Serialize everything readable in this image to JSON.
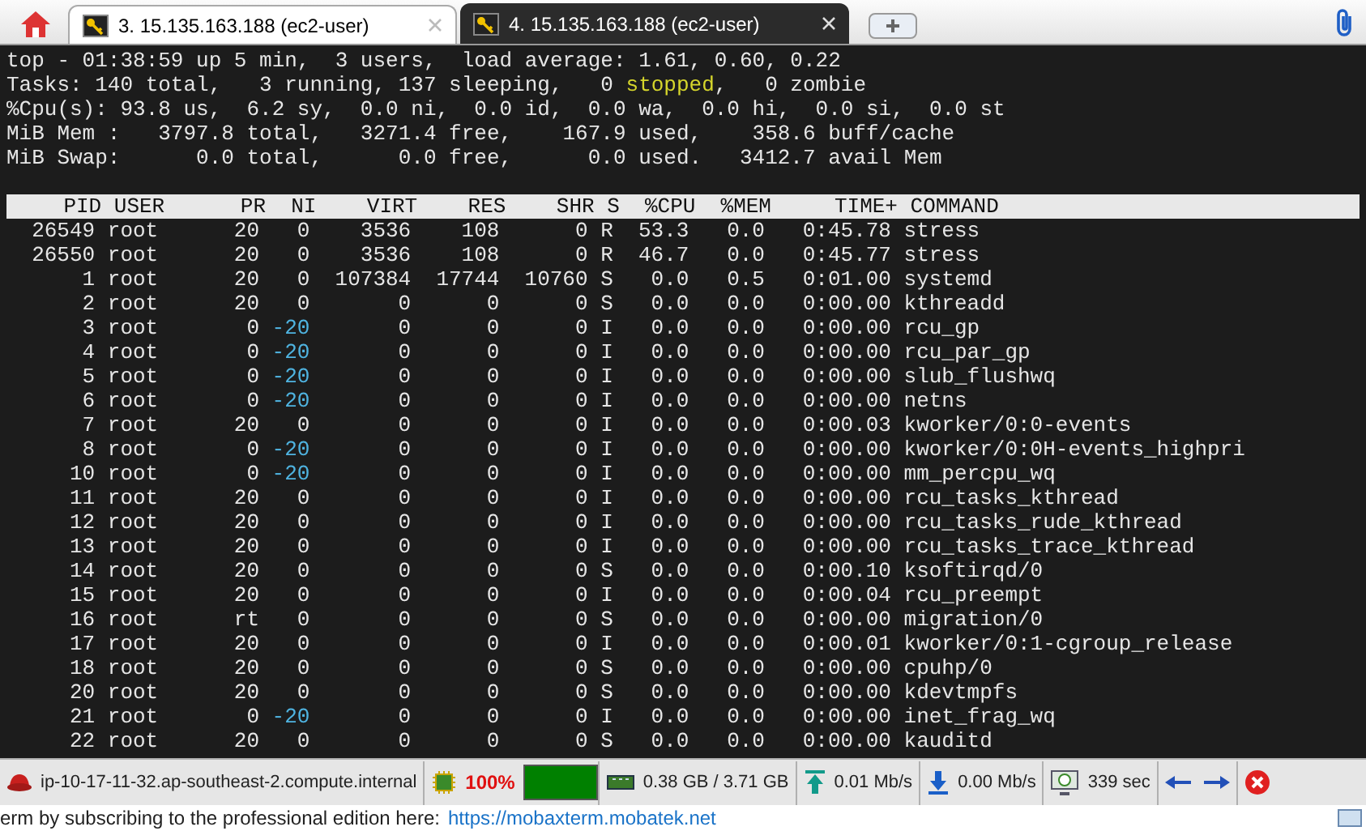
{
  "tabs": [
    {
      "label": "3. 15.135.163.188 (ec2-user)",
      "selected": false
    },
    {
      "label": "4. 15.135.163.188 (ec2-user)",
      "selected": true
    }
  ],
  "terminal": {
    "summary_lines": [
      [
        {
          "text": "top - 01:38:59 up 5 min,  3 users,  load average: 1.61, 0.60, 0.22",
          "highlighted": false
        }
      ],
      [
        {
          "text": "Tasks: 140 total,   3 running, 137 sleeping,   0 ",
          "highlighted": false
        },
        {
          "text": "stopped",
          "highlighted": true
        },
        {
          "text": ",   0 zombie",
          "highlighted": false
        }
      ],
      [
        {
          "text": "%Cpu(s): 93.8 us,  6.2 sy,  0.0 ni,  0.0 id,  0.0 wa,  0.0 hi,  0.0 si,  0.0 st",
          "highlighted": false
        }
      ],
      [
        {
          "text": "MiB Mem :   3797.8 total,   3271.4 free,    167.9 used,    358.6 buff/cache",
          "highlighted": false
        }
      ],
      [
        {
          "text": "MiB Swap:      0.0 total,      0.0 free,      0.0 used.   3412.7 avail Mem",
          "highlighted": false
        }
      ]
    ],
    "columns": [
      "PID",
      "USER",
      "PR",
      "NI",
      "VIRT",
      "RES",
      "SHR",
      "S",
      "%CPU",
      "%MEM",
      "TIME+",
      "COMMAND"
    ],
    "rows": [
      {
        "cells": [
          "26549",
          "root",
          "20",
          "0",
          "3536",
          "108",
          "0",
          "R",
          "53.3",
          "0.0",
          "0:45.78",
          "stress"
        ],
        "ni_highlighted": false
      },
      {
        "cells": [
          "26550",
          "root",
          "20",
          "0",
          "3536",
          "108",
          "0",
          "R",
          "46.7",
          "0.0",
          "0:45.77",
          "stress"
        ],
        "ni_highlighted": false
      },
      {
        "cells": [
          "1",
          "root",
          "20",
          "0",
          "107384",
          "17744",
          "10760",
          "S",
          "0.0",
          "0.5",
          "0:01.00",
          "systemd"
        ],
        "ni_highlighted": false
      },
      {
        "cells": [
          "2",
          "root",
          "20",
          "0",
          "0",
          "0",
          "0",
          "S",
          "0.0",
          "0.0",
          "0:00.00",
          "kthreadd"
        ],
        "ni_highlighted": false
      },
      {
        "cells": [
          "3",
          "root",
          "0",
          "-20",
          "0",
          "0",
          "0",
          "I",
          "0.0",
          "0.0",
          "0:00.00",
          "rcu_gp"
        ],
        "ni_highlighted": true
      },
      {
        "cells": [
          "4",
          "root",
          "0",
          "-20",
          "0",
          "0",
          "0",
          "I",
          "0.0",
          "0.0",
          "0:00.00",
          "rcu_par_gp"
        ],
        "ni_highlighted": true
      },
      {
        "cells": [
          "5",
          "root",
          "0",
          "-20",
          "0",
          "0",
          "0",
          "I",
          "0.0",
          "0.0",
          "0:00.00",
          "slub_flushwq"
        ],
        "ni_highlighted": true
      },
      {
        "cells": [
          "6",
          "root",
          "0",
          "-20",
          "0",
          "0",
          "0",
          "I",
          "0.0",
          "0.0",
          "0:00.00",
          "netns"
        ],
        "ni_highlighted": true
      },
      {
        "cells": [
          "7",
          "root",
          "20",
          "0",
          "0",
          "0",
          "0",
          "I",
          "0.0",
          "0.0",
          "0:00.03",
          "kworker/0:0-events"
        ],
        "ni_highlighted": false
      },
      {
        "cells": [
          "8",
          "root",
          "0",
          "-20",
          "0",
          "0",
          "0",
          "I",
          "0.0",
          "0.0",
          "0:00.00",
          "kworker/0:0H-events_highpri"
        ],
        "ni_highlighted": true
      },
      {
        "cells": [
          "10",
          "root",
          "0",
          "-20",
          "0",
          "0",
          "0",
          "I",
          "0.0",
          "0.0",
          "0:00.00",
          "mm_percpu_wq"
        ],
        "ni_highlighted": true
      },
      {
        "cells": [
          "11",
          "root",
          "20",
          "0",
          "0",
          "0",
          "0",
          "I",
          "0.0",
          "0.0",
          "0:00.00",
          "rcu_tasks_kthread"
        ],
        "ni_highlighted": false
      },
      {
        "cells": [
          "12",
          "root",
          "20",
          "0",
          "0",
          "0",
          "0",
          "I",
          "0.0",
          "0.0",
          "0:00.00",
          "rcu_tasks_rude_kthread"
        ],
        "ni_highlighted": false
      },
      {
        "cells": [
          "13",
          "root",
          "20",
          "0",
          "0",
          "0",
          "0",
          "I",
          "0.0",
          "0.0",
          "0:00.00",
          "rcu_tasks_trace_kthread"
        ],
        "ni_highlighted": false
      },
      {
        "cells": [
          "14",
          "root",
          "20",
          "0",
          "0",
          "0",
          "0",
          "S",
          "0.0",
          "0.0",
          "0:00.10",
          "ksoftirqd/0"
        ],
        "ni_highlighted": false
      },
      {
        "cells": [
          "15",
          "root",
          "20",
          "0",
          "0",
          "0",
          "0",
          "I",
          "0.0",
          "0.0",
          "0:00.04",
          "rcu_preempt"
        ],
        "ni_highlighted": false
      },
      {
        "cells": [
          "16",
          "root",
          "rt",
          "0",
          "0",
          "0",
          "0",
          "S",
          "0.0",
          "0.0",
          "0:00.00",
          "migration/0"
        ],
        "ni_highlighted": false
      },
      {
        "cells": [
          "17",
          "root",
          "20",
          "0",
          "0",
          "0",
          "0",
          "I",
          "0.0",
          "0.0",
          "0:00.01",
          "kworker/0:1-cgroup_release"
        ],
        "ni_highlighted": false
      },
      {
        "cells": [
          "18",
          "root",
          "20",
          "0",
          "0",
          "0",
          "0",
          "S",
          "0.0",
          "0.0",
          "0:00.00",
          "cpuhp/0"
        ],
        "ni_highlighted": false
      },
      {
        "cells": [
          "20",
          "root",
          "20",
          "0",
          "0",
          "0",
          "0",
          "S",
          "0.0",
          "0.0",
          "0:00.00",
          "kdevtmpfs"
        ],
        "ni_highlighted": false
      },
      {
        "cells": [
          "21",
          "root",
          "0",
          "-20",
          "0",
          "0",
          "0",
          "I",
          "0.0",
          "0.0",
          "0:00.00",
          "inet_frag_wq"
        ],
        "ni_highlighted": true
      },
      {
        "cells": [
          "22",
          "root",
          "20",
          "0",
          "0",
          "0",
          "0",
          "S",
          "0.0",
          "0.0",
          "0:00.00",
          "kauditd"
        ],
        "ni_highlighted": false
      }
    ]
  },
  "status_bar": {
    "host": "ip-10-17-11-32.ap-southeast-2.compute.internal",
    "cpu": "100%",
    "memory": "0.38 GB / 3.71 GB",
    "upload": "0.01 Mb/s",
    "download": "0.00 Mb/s",
    "uptime": "339 sec"
  },
  "footer": {
    "text": "erm by subscribing to the professional edition here:",
    "link": "https://mobaxterm.mobatek.net"
  }
}
